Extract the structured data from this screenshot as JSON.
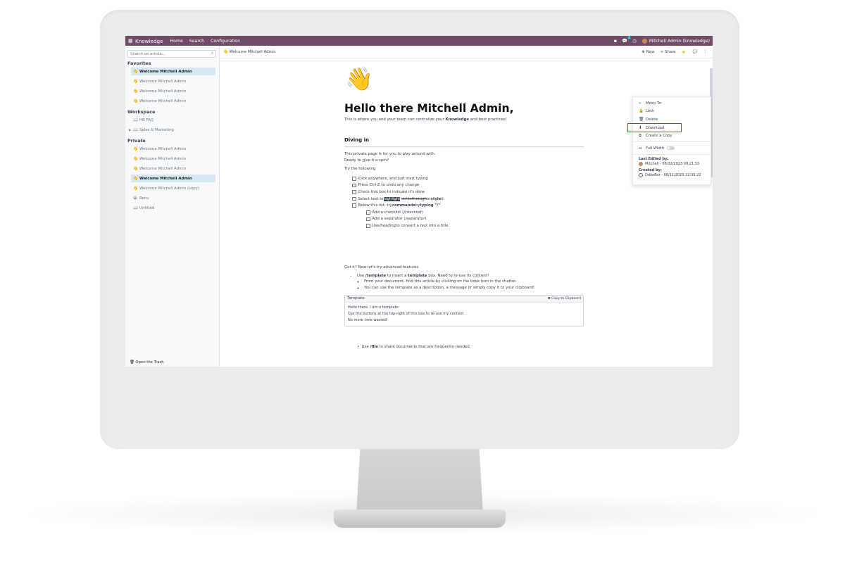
{
  "navbar": {
    "app_name": "Knowledge",
    "menus": [
      "Home",
      "Search",
      "Configuration"
    ],
    "chat_badge": "4",
    "user": "Mitchell Admin (knowledge)"
  },
  "sidebar": {
    "search_placeholder": "Search an article...",
    "favorites_title": "Favorites",
    "favorites": [
      {
        "icon": "👋",
        "label": "Welcome Mitchell Admin"
      },
      {
        "icon": "👋",
        "label": "Welcome Mitchell Admin"
      },
      {
        "icon": "👋",
        "label": "Welcome Mitchell Admin"
      },
      {
        "icon": "👋",
        "label": "Welcome Mitchell Admin"
      }
    ],
    "workspace_title": "Workspace",
    "workspace": [
      {
        "icon": "📖",
        "label": "HR FAQ"
      },
      {
        "icon": "📖",
        "label": "Sales & Marketing"
      }
    ],
    "private_title": "Private",
    "private": [
      {
        "icon": "👋",
        "label": "Welcome Mitchell Admin"
      },
      {
        "icon": "👋",
        "label": "Welcome Mitchell Admin"
      },
      {
        "icon": "👋",
        "label": "Welcome Mitchell Admin"
      },
      {
        "icon": "👋",
        "label": "Welcome Mitchell Admin"
      },
      {
        "icon": "👋",
        "label": "Welcome Mitchell Admin (copy)"
      },
      {
        "icon": "😀",
        "label": "Renu"
      },
      {
        "icon": "📖",
        "label": "Untitled"
      }
    ],
    "trash": "Open the Trash"
  },
  "topbar": {
    "breadcrumb_icon": "👋",
    "breadcrumb": "Welcome Mitchell Admin",
    "new_label": "New",
    "share_label": "Share"
  },
  "dropdown": {
    "move_to": "Move To",
    "lock": "Lock",
    "delete": "Delete",
    "download": "Download",
    "create_copy": "Create a Copy",
    "full_width": "Full Width",
    "last_edited_title": "Last Edited by:",
    "last_edited_value": "Mitchell - 06/22/2023 09:21:55",
    "created_title": "Created by:",
    "created_value": "OdooBot - 06/11/2023 22:35:22"
  },
  "article": {
    "emoji": "👋",
    "title": "Hello there Mitchell Admin,",
    "lead_pre": "This is where you and your team can centralize your ",
    "lead_bold": "Knowledge",
    "lead_post": " and best practices!",
    "section": "Diving in",
    "intro1": "This private page is for you to play around with.",
    "intro2": "Ready to give it a spin?",
    "try_label": "Try the following",
    "todos": [
      "Click anywhere, and just start typing",
      "Press Ctrl-Z to undo any change",
      "Check this box to indicate it's done"
    ],
    "todo4_pre": "Select text to ",
    "todo4_highlight": "highlight",
    "todo4_strike": "strikethrough",
    "todo4_or": " or ",
    "todo4_style": "style",
    "todo4_it": " it",
    "todo5_pre": "Below this list, try ",
    "todo5_commands": "commands",
    "todo5_by": " by ",
    "todo5_typing": "typing \"/\"",
    "subtodo1_pre": "Add a checklist (",
    "subtodo1_cmd": "/checklist",
    "subtodo1_post": ")",
    "subtodo2_pre": "Add a separator (",
    "subtodo2_cmd": "/separator",
    "subtodo2_post": ")",
    "subtodo3_pre": "Use ",
    "subtodo3_cmd": "/heading",
    "subtodo3_post": " to convert a text into a title",
    "advanced": "Got it? Now let's try advanced features",
    "bullet1_pre": "Use ",
    "bullet1_cmd": "/template",
    "bullet1_mid": " to insert a ",
    "bullet1_bold": "template",
    "bullet1_post": " box. Need to re-use its content?",
    "sub_bullet1": "From your document, find this article by clicking on the book icon in the chatter.",
    "sub_bullet2": "You can use the template as a description, a message or simply copy it to your clipboard!",
    "template_title": "Template",
    "template_copy": "Copy to Clipboard",
    "template_lines": [
      "Hello there, I am a template",
      "Use the buttons at the top-right of this box to re-use my content.",
      "No more time wasted!"
    ],
    "file_pre": "Use ",
    "file_cmd": "/file",
    "file_post": " to share documents that are frequently needed"
  }
}
